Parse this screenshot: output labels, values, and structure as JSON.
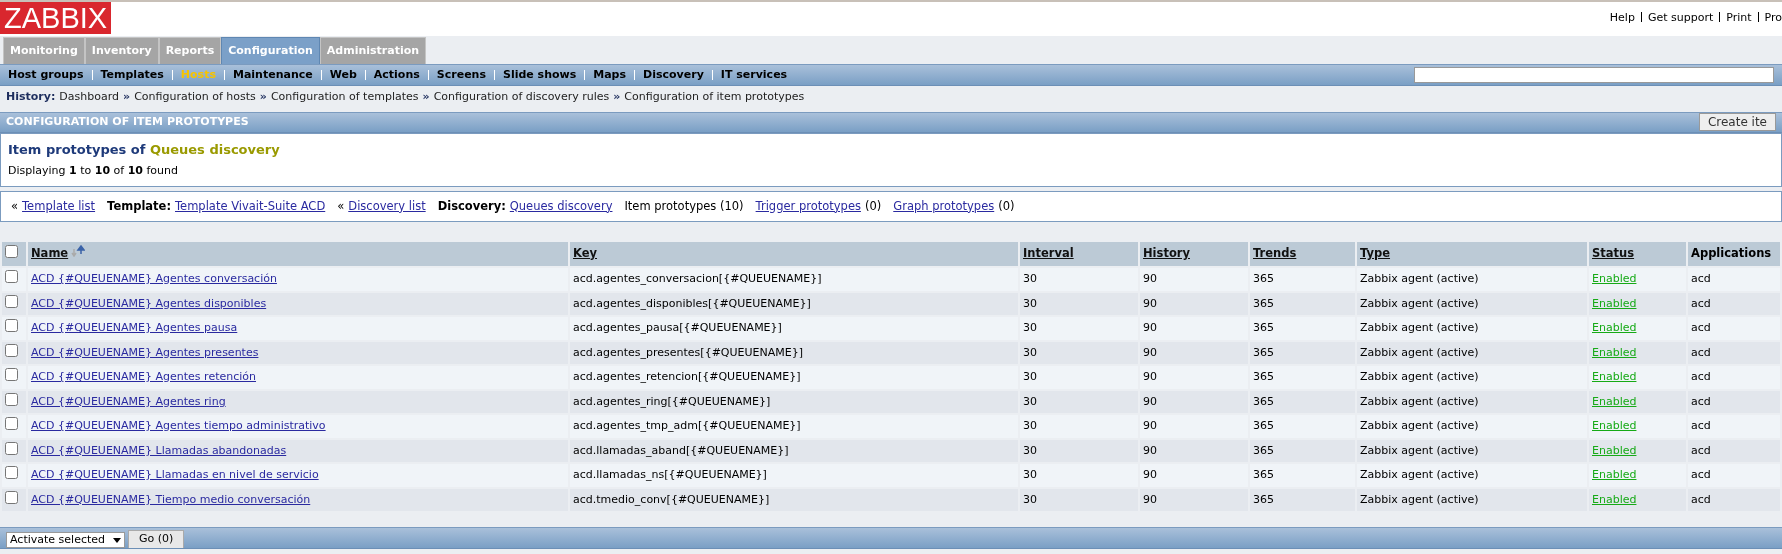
{
  "header": {
    "logo": "ZABBIX",
    "links": [
      "Help",
      "Get support",
      "Print",
      "Pro"
    ]
  },
  "main_menu": [
    {
      "label": "Monitoring",
      "selected": false
    },
    {
      "label": "Inventory",
      "selected": false
    },
    {
      "label": "Reports",
      "selected": false
    },
    {
      "label": "Configuration",
      "selected": true
    },
    {
      "label": "Administration",
      "selected": false
    }
  ],
  "sub_menu": [
    {
      "label": "Host groups",
      "selected": false
    },
    {
      "label": "Templates",
      "selected": false
    },
    {
      "label": "Hosts",
      "selected": true
    },
    {
      "label": "Maintenance",
      "selected": false
    },
    {
      "label": "Web",
      "selected": false
    },
    {
      "label": "Actions",
      "selected": false
    },
    {
      "label": "Screens",
      "selected": false
    },
    {
      "label": "Slide shows",
      "selected": false
    },
    {
      "label": "Maps",
      "selected": false
    },
    {
      "label": "Discovery",
      "selected": false
    },
    {
      "label": "IT services",
      "selected": false
    }
  ],
  "history": {
    "label": "History:",
    "separator": "»",
    "items": [
      "Dashboard",
      "Configuration of hosts",
      "Configuration of templates",
      "Configuration of discovery rules",
      "Configuration of item prototypes"
    ]
  },
  "section": {
    "title": "CONFIGURATION OF ITEM PROTOTYPES",
    "create_button": "Create ite"
  },
  "summary": {
    "title": "Item prototypes of",
    "name": "Queues discovery",
    "displaying": "Displaying **1** to **10** of **10** found"
  },
  "nav_links": [
    {
      "kind": "back",
      "prefix": "«",
      "link": "Template list"
    },
    {
      "kind": "labeled",
      "label": "Template:",
      "link": "Template Vivait-Suite ACD"
    },
    {
      "kind": "back",
      "prefix": "«",
      "link": "Discovery list"
    },
    {
      "kind": "labeled",
      "label": "Discovery:",
      "link": "Queues discovery"
    },
    {
      "kind": "text",
      "text": "Item prototypes (10)"
    },
    {
      "kind": "count",
      "link": "Trigger prototypes",
      "count": "(0)"
    },
    {
      "kind": "count",
      "link": "Graph prototypes",
      "count": "(0)"
    }
  ],
  "table": {
    "all_checked": false,
    "columns": [
      {
        "label": "Name",
        "sortable": true,
        "sorted": true
      },
      {
        "label": "Key",
        "sortable": true,
        "sorted": false
      },
      {
        "label": "Interval",
        "sortable": true,
        "sorted": false
      },
      {
        "label": "History",
        "sortable": true,
        "sorted": false
      },
      {
        "label": "Trends",
        "sortable": true,
        "sorted": false
      },
      {
        "label": "Type",
        "sortable": true,
        "sorted": false
      },
      {
        "label": "Status",
        "sortable": true,
        "sorted": false
      },
      {
        "label": "Applications",
        "sortable": false,
        "sorted": false
      }
    ],
    "rows": [
      {
        "checked": false,
        "name": "ACD {#QUEUENAME} Agentes conversación",
        "key": "acd.agentes_conversacion[{#QUEUENAME}]",
        "interval": "30",
        "history": "90",
        "trends": "365",
        "type": "Zabbix agent (active)",
        "status": "Enabled",
        "applications": "acd"
      },
      {
        "checked": false,
        "name": "ACD {#QUEUENAME} Agentes disponibles",
        "key": "acd.agentes_disponibles[{#QUEUENAME}]",
        "interval": "30",
        "history": "90",
        "trends": "365",
        "type": "Zabbix agent (active)",
        "status": "Enabled",
        "applications": "acd"
      },
      {
        "checked": false,
        "name": "ACD {#QUEUENAME} Agentes pausa",
        "key": "acd.agentes_pausa[{#QUEUENAME}]",
        "interval": "30",
        "history": "90",
        "trends": "365",
        "type": "Zabbix agent (active)",
        "status": "Enabled",
        "applications": "acd"
      },
      {
        "checked": false,
        "name": "ACD {#QUEUENAME} Agentes presentes",
        "key": "acd.agentes_presentes[{#QUEUENAME}]",
        "interval": "30",
        "history": "90",
        "trends": "365",
        "type": "Zabbix agent (active)",
        "status": "Enabled",
        "applications": "acd"
      },
      {
        "checked": false,
        "name": "ACD {#QUEUENAME} Agentes retención",
        "key": "acd.agentes_retencion[{#QUEUENAME}]",
        "interval": "30",
        "history": "90",
        "trends": "365",
        "type": "Zabbix agent (active)",
        "status": "Enabled",
        "applications": "acd"
      },
      {
        "checked": false,
        "name": "ACD {#QUEUENAME} Agentes ring",
        "key": "acd.agentes_ring[{#QUEUENAME}]",
        "interval": "30",
        "history": "90",
        "trends": "365",
        "type": "Zabbix agent (active)",
        "status": "Enabled",
        "applications": "acd"
      },
      {
        "checked": false,
        "name": "ACD {#QUEUENAME} Agentes tiempo administrativo",
        "key": "acd.agentes_tmp_adm[{#QUEUENAME}]",
        "interval": "30",
        "history": "90",
        "trends": "365",
        "type": "Zabbix agent (active)",
        "status": "Enabled",
        "applications": "acd"
      },
      {
        "checked": false,
        "name": "ACD {#QUEUENAME} Llamadas abandonadas",
        "key": "acd.llamadas_aband[{#QUEUENAME}]",
        "interval": "30",
        "history": "90",
        "trends": "365",
        "type": "Zabbix agent (active)",
        "status": "Enabled",
        "applications": "acd"
      },
      {
        "checked": false,
        "name": "ACD {#QUEUENAME} Llamadas en nivel de servicio",
        "key": "acd.llamadas_ns[{#QUEUENAME}]",
        "interval": "30",
        "history": "90",
        "trends": "365",
        "type": "Zabbix agent (active)",
        "status": "Enabled",
        "applications": "acd"
      },
      {
        "checked": false,
        "name": "ACD {#QUEUENAME} Tiempo medio conversación",
        "key": "acd.tmedio_conv[{#QUEUENAME}]",
        "interval": "30",
        "history": "90",
        "trends": "365",
        "type": "Zabbix agent (active)",
        "status": "Enabled",
        "applications": "acd"
      }
    ]
  },
  "footer": {
    "action": "Activate selected",
    "go_button": "Go (0)"
  }
}
